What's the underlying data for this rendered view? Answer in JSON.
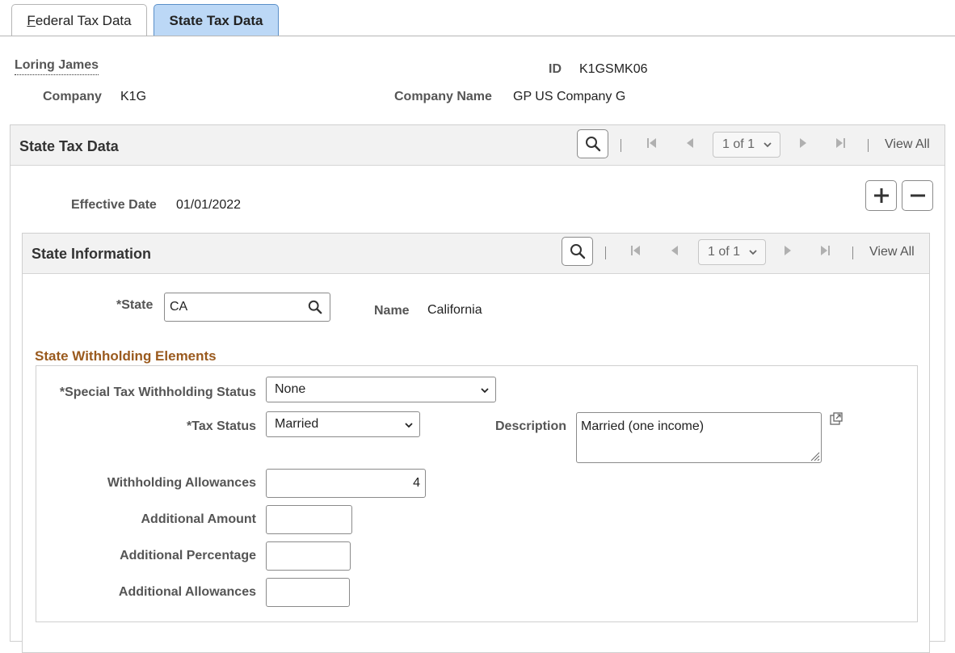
{
  "tabs": [
    {
      "label_first": "F",
      "label_rest": "ederal Tax Data",
      "active": false
    },
    {
      "label": "State Tax Data",
      "active": true
    }
  ],
  "employee": {
    "name": "Loring James",
    "id_label": "ID",
    "id_value": "K1GSMK06",
    "company_label": "Company",
    "company_value": "K1G",
    "company_name_label": "Company Name",
    "company_name_value": "GP US Company G"
  },
  "state_tax_grid": {
    "title": "State Tax Data",
    "pager": "1 of 1",
    "view_all": "View All",
    "effective_date_label": "Effective Date",
    "effective_date_value": "01/01/2022"
  },
  "state_info_grid": {
    "title": "State Information",
    "pager": "1 of 1",
    "view_all": "View All",
    "state_label": "*State",
    "state_value": "CA",
    "name_label": "Name",
    "name_value": "California"
  },
  "withholding": {
    "section_title": "State Withholding Elements",
    "special_status_label": "*Special Tax Withholding Status",
    "special_status_value": "None",
    "tax_status_label": "*Tax Status",
    "tax_status_value": "Married",
    "description_label": "Description",
    "description_value": "Married (one income)",
    "withholding_allowances_label": "Withholding Allowances",
    "withholding_allowances_value": "4",
    "additional_amount_label": "Additional Amount",
    "additional_amount_value": "",
    "additional_percentage_label": "Additional Percentage",
    "additional_percentage_value": "",
    "additional_allowances_label": "Additional Allowances",
    "additional_allowances_value": ""
  },
  "colors": {
    "active_tab": "#bcd8f6",
    "section_title": "#9a5a1e",
    "header_bg": "#f2f2f2"
  }
}
